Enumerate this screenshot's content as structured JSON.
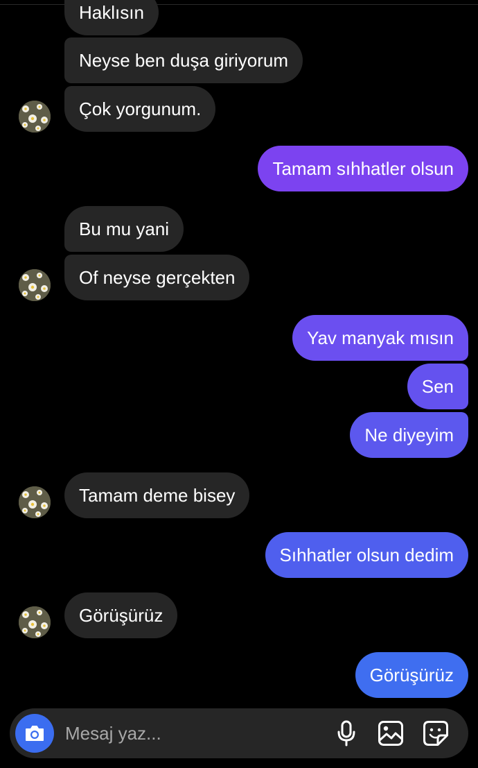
{
  "conversation": {
    "messages": [
      {
        "direction": "in",
        "text": "Haklısın"
      },
      {
        "direction": "in",
        "text": "Neyse ben duşa giriyorum"
      },
      {
        "direction": "in",
        "text": "Çok yorgunum."
      },
      {
        "direction": "out",
        "text": "Tamam sıhhatler olsun"
      },
      {
        "direction": "in",
        "text": "Bu mu yani"
      },
      {
        "direction": "in",
        "text": "Of neyse gerçekten"
      },
      {
        "direction": "out",
        "text": "Yav manyak mısın"
      },
      {
        "direction": "out",
        "text": "Sen"
      },
      {
        "direction": "out",
        "text": "Ne diyeyim"
      },
      {
        "direction": "in",
        "text": "Tamam deme bisey"
      },
      {
        "direction": "out",
        "text": "Sıhhatler olsun dedim"
      },
      {
        "direction": "in",
        "text": "Görüşürüz"
      },
      {
        "direction": "out",
        "text": "Görüşürüz"
      }
    ]
  },
  "composer": {
    "placeholder": "Mesaj yaz...",
    "icons": [
      "camera-icon",
      "microphone-icon",
      "gallery-icon",
      "sticker-icon"
    ]
  },
  "colors": {
    "background": "#000000",
    "incoming_bubble": "#262626",
    "outgoing_gradient_top": "#8a3ff0",
    "outgoing_gradient_bottom": "#3f6ef0",
    "camera_button": "#3b6df0"
  }
}
